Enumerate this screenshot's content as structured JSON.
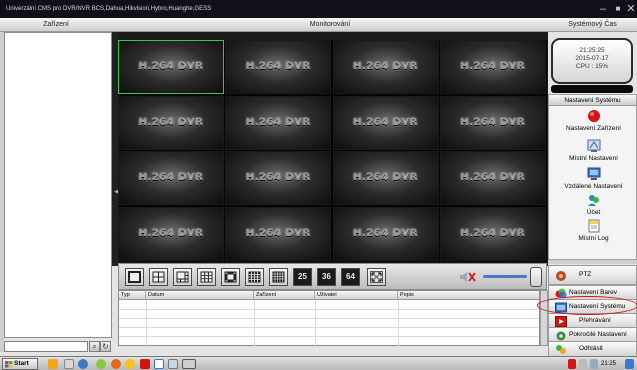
{
  "window": {
    "title": "Univerzální CMS pro DVR/NVR BCS,Dahua,Hikvision,Hybro,Huanghe,GESS"
  },
  "headers": {
    "devices": "Zařízení",
    "monitoring": "Monitorování",
    "system_time": "Systémový Čas"
  },
  "video_wall": {
    "cell_label": "H.264 DVR",
    "selected_cell": 0,
    "rows": 4,
    "cols": 4
  },
  "layout_buttons": [
    "25",
    "36",
    "64"
  ],
  "log_table": {
    "columns": [
      "Typ",
      "Datum",
      "Zařízení",
      "Uživatel",
      "Popis"
    ]
  },
  "clock": {
    "time": "21:25:25",
    "date": "2015-07-17",
    "cpu": "CPU : 15%"
  },
  "settings_panel": {
    "title": "Nastavení Systému",
    "items": [
      {
        "label": "Nastavení Zařízení",
        "icon": "device-settings-icon"
      },
      {
        "label": "Místní Nastavení",
        "icon": "local-settings-icon"
      },
      {
        "label": "Vzdálené Nastavení",
        "icon": "remote-settings-icon"
      },
      {
        "label": "Účet",
        "icon": "account-icon"
      },
      {
        "label": "Místní Log",
        "icon": "local-log-icon"
      }
    ]
  },
  "controls": [
    {
      "label": "PTZ",
      "icon": "ptz-icon"
    },
    {
      "label": "Nastavení Barev",
      "icon": "color-settings-icon"
    },
    {
      "label": "Nastavení Systému",
      "icon": "system-settings-icon"
    },
    {
      "label": "Přehrávání",
      "icon": "playback-icon"
    },
    {
      "label": "Pokročilé Nastavení",
      "icon": "advanced-settings-icon"
    },
    {
      "label": "Odhlásit",
      "icon": "logout-icon"
    }
  ],
  "taskbar": {
    "start": "Start",
    "time": "21:25"
  },
  "colors": {
    "selected_cell_border": "#3cc83c",
    "highlight_ring": "#d41414",
    "volume": "#4a78c8"
  }
}
